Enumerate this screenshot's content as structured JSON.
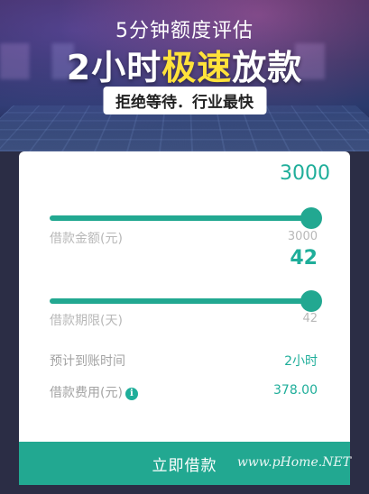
{
  "banner": {
    "line1": "5分钟额度评估",
    "line2_prefix": "2小时",
    "line2_highlight": "极速",
    "line2_suffix": "放款",
    "tagline": "拒绝等待．行业最快",
    "highlight_color": "#ffe23a"
  },
  "loan_amount": {
    "value": "3000",
    "label": "借款金额(元)",
    "max": "3000",
    "slider_fraction": 1.0
  },
  "loan_term": {
    "value": "42",
    "label": "借款期限(天)",
    "max": "42",
    "slider_fraction": 1.0
  },
  "summary": {
    "arrival_label": "预计到账时间",
    "arrival_value": "2小时",
    "fee_label": "借款费用(元)",
    "fee_icon": "info-icon",
    "fee_value": "378.00"
  },
  "cta": {
    "label": "立即借款"
  },
  "watermark": "www.pHome.NET",
  "colors": {
    "accent": "#22a891",
    "background": "#2b2d45"
  }
}
